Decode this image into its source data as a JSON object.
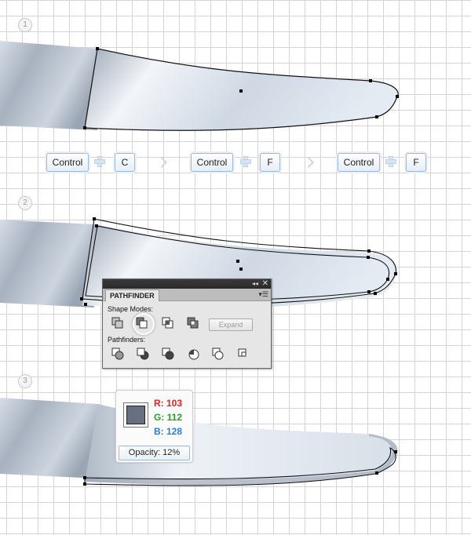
{
  "steps": [
    "1",
    "2",
    "3"
  ],
  "shortcuts": {
    "group1": {
      "modifier": "Control",
      "key": "C"
    },
    "group2": {
      "modifier": "Control",
      "key": "F"
    },
    "group3": {
      "modifier": "Control",
      "key": "F"
    }
  },
  "pathfinder": {
    "title": "PATHFINDER",
    "shape_modes_label": "Shape Modes:",
    "pathfinders_label": "Pathfinders:",
    "expand_label": "Expand",
    "collapse_glyph": "◂◂",
    "close_glyph": "✕",
    "menu_glyph": "▾☰",
    "highlighted_mode": "minus-front",
    "shape_mode_icons": [
      "unite-icon",
      "minus-front-icon",
      "intersect-icon",
      "exclude-icon"
    ],
    "pathfinder_icons": [
      "divide-icon",
      "trim-icon",
      "merge-icon",
      "crop-icon",
      "outline-icon",
      "minus-back-icon"
    ]
  },
  "color_panel": {
    "r_label": "R: 103",
    "g_label": "G: 112",
    "b_label": "B: 128",
    "opacity_label": "Opacity: 12%",
    "fill_color": "#677080",
    "r_color": "#e02020",
    "g_color": "#2aa02a",
    "b_color": "#2a7fd4"
  }
}
